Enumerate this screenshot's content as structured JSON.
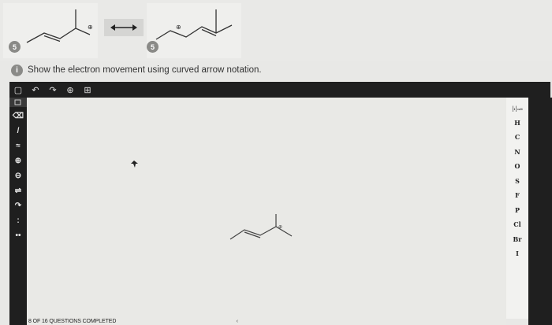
{
  "question": {
    "instruction": "Show the electron movement using curved arrow notation.",
    "resonance_arrow": "⟷",
    "charge_symbol": "⊕",
    "answer_badge_symbol": "5",
    "info_badge_symbol": "i"
  },
  "toolbar": {
    "tools": [
      {
        "name": "new-icon",
        "glyph": "▢"
      },
      {
        "name": "undo-icon",
        "glyph": "↶"
      },
      {
        "name": "redo-icon",
        "glyph": "↷"
      },
      {
        "name": "zoom-icon",
        "glyph": "⊕"
      },
      {
        "name": "template-icon",
        "glyph": "⊞"
      }
    ]
  },
  "left_tools": [
    {
      "name": "eraser-icon",
      "glyph": "⌫"
    },
    {
      "name": "single-bond-icon",
      "glyph": "/"
    },
    {
      "name": "chain-icon",
      "glyph": "≈"
    },
    {
      "name": "positive-charge-icon",
      "glyph": "⊕"
    },
    {
      "name": "negative-charge-icon",
      "glyph": "⊖"
    },
    {
      "name": "arrow-icon",
      "glyph": "⇌"
    },
    {
      "name": "curved-arrow-icon",
      "glyph": "↷"
    },
    {
      "name": "lone-pair-icon",
      "glyph": ":"
    },
    {
      "name": "radical-icon",
      "glyph": "••"
    }
  ],
  "elements": {
    "periodic_label": "|ᵢ|ₙᵢᵢ",
    "list": [
      "H",
      "C",
      "N",
      "O",
      "S",
      "F",
      "P",
      "Cl",
      "Br",
      "I"
    ]
  },
  "footer": {
    "progress": "8 OF 16 QUESTIONS COMPLETED",
    "nav": "‹"
  }
}
